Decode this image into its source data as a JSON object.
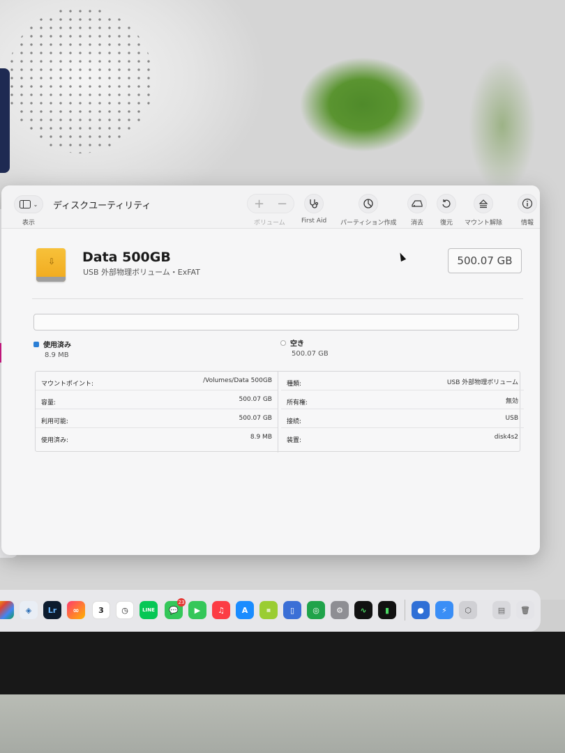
{
  "toolbar": {
    "title": "ディスクユーティリティ",
    "sidebar_label": "表示",
    "volume_label": "ボリューム",
    "volume_add": "+",
    "volume_remove": "−",
    "buttons": [
      {
        "label": "First Aid",
        "icon": "stethoscope-icon"
      },
      {
        "label": "パーティション作成",
        "icon": "pie-chart-icon"
      },
      {
        "label": "消去",
        "icon": "erase-icon"
      },
      {
        "label": "復元",
        "icon": "restore-icon"
      },
      {
        "label": "マウント解除",
        "icon": "eject-icon"
      },
      {
        "label": "情報",
        "icon": "info-icon"
      }
    ]
  },
  "disk": {
    "name": "Data 500GB",
    "subtitle": "USB 外部物理ボリューム・ExFAT",
    "capacity": "500.07 GB"
  },
  "usage": {
    "used_label": "使用済み",
    "used_value": "8.9 MB",
    "free_label": "空き",
    "free_value": "500.07 GB",
    "used_fraction": 1.78e-05,
    "used_color": "#2b7fd6"
  },
  "info": {
    "left": [
      {
        "key": "マウントポイント:",
        "value": "/Volumes/Data 500GB"
      },
      {
        "key": "容量:",
        "value": "500.07 GB"
      },
      {
        "key": "利用可能:",
        "value": "500.07 GB"
      },
      {
        "key": "使用済み:",
        "value": "8.9 MB"
      }
    ],
    "right": [
      {
        "key": "種類:",
        "value": "USB 外部物理ボリューム"
      },
      {
        "key": "所有権:",
        "value": "無効"
      },
      {
        "key": "接続:",
        "value": "USB"
      },
      {
        "key": "装置:",
        "value": "disk4s2"
      }
    ]
  },
  "dock": {
    "lr_label": "Lr",
    "calendar_day": "3",
    "messages_badge": "23"
  }
}
